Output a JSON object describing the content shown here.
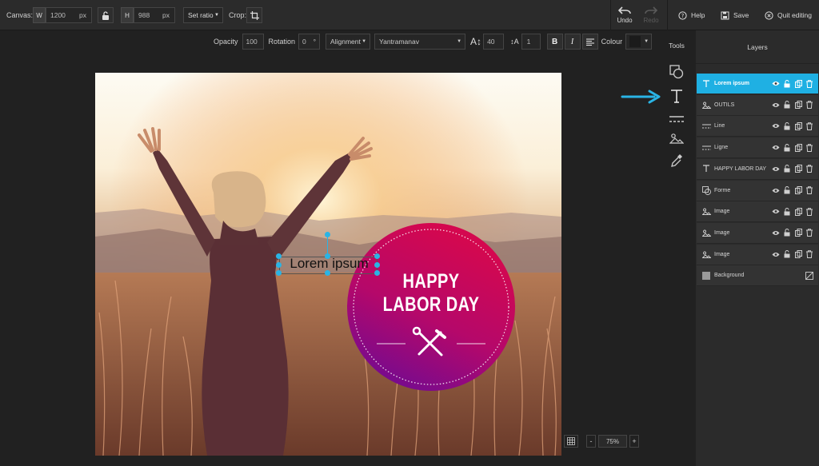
{
  "topbar": {
    "canvas_label": "Canvas:",
    "width_letter": "W",
    "width_value": "1200",
    "width_unit": "px",
    "height_letter": "H",
    "height_value": "988",
    "height_unit": "px",
    "ratio_label": "Set ratio",
    "crop_label": "Crop:",
    "undo_label": "Undo",
    "redo_label": "Redo",
    "help_label": "Help",
    "save_label": "Save",
    "quit_label": "Quit editing"
  },
  "text_toolbar": {
    "opacity_label": "Opacity",
    "opacity_value": "100",
    "rotation_label": "Rotation",
    "rotation_value": "0",
    "rotation_unit": "°",
    "alignment_label": "Alignment",
    "font_name": "Yantramanav",
    "font_size": "40",
    "line_height": "1",
    "bold": "B",
    "italic": "I",
    "colour_label": "Colour"
  },
  "tools": {
    "title": "Tools"
  },
  "layers": {
    "title": "Layers",
    "items": [
      {
        "name": "Lorem ipsum",
        "icon": "text-icon",
        "selected": true
      },
      {
        "name": "OUTILS",
        "icon": "image-icon"
      },
      {
        "name": "Line",
        "icon": "line-icon"
      },
      {
        "name": "Ligne",
        "icon": "line-icon"
      },
      {
        "name": "HAPPY LABOR DAY",
        "icon": "text-icon"
      },
      {
        "name": "Forme",
        "icon": "shape-icon"
      },
      {
        "name": "Image",
        "icon": "image-icon"
      },
      {
        "name": "Image",
        "icon": "image-icon"
      },
      {
        "name": "Image",
        "icon": "image-icon"
      },
      {
        "name": "Background",
        "icon": "background-icon"
      }
    ]
  },
  "canvas": {
    "text_layer": "Lorem ipsum",
    "badge_line1": "HAPPY",
    "badge_line2": "LABOR DAY"
  },
  "zoom": {
    "minus": "-",
    "value": "75%",
    "plus": "+"
  },
  "colors": {
    "accent": "#1fb0e3",
    "badge_top": "#d4084f",
    "badge_bottom": "#7a0a8c",
    "panel": "#2b2b2b",
    "workspace": "#212121"
  }
}
